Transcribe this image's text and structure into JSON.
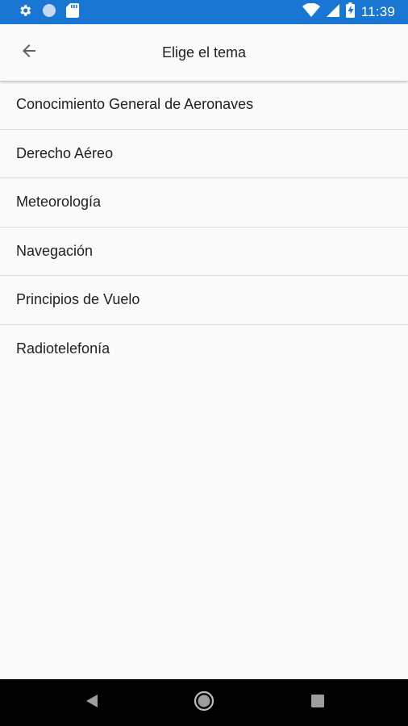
{
  "status_bar": {
    "time": "11:39",
    "icons": [
      "gear-icon",
      "circle-icon",
      "sd-card-icon",
      "wifi-icon",
      "signal-icon",
      "battery-charging-icon"
    ]
  },
  "toolbar": {
    "back_icon": "arrow-back-icon",
    "title": "Elige el tema"
  },
  "topics": [
    "Conocimiento General de Aeronaves",
    "Derecho Aéreo",
    "Meteorología",
    "Navegación",
    "Principios de Vuelo",
    "Radiotelefonía"
  ],
  "nav_bar": {
    "icons": [
      "nav-back-icon",
      "nav-home-icon",
      "nav-recent-icon"
    ]
  },
  "colors": {
    "status_bar": "#1976d2",
    "background": "#fafafa",
    "divider": "#e0e0e0",
    "text": "#212121"
  }
}
